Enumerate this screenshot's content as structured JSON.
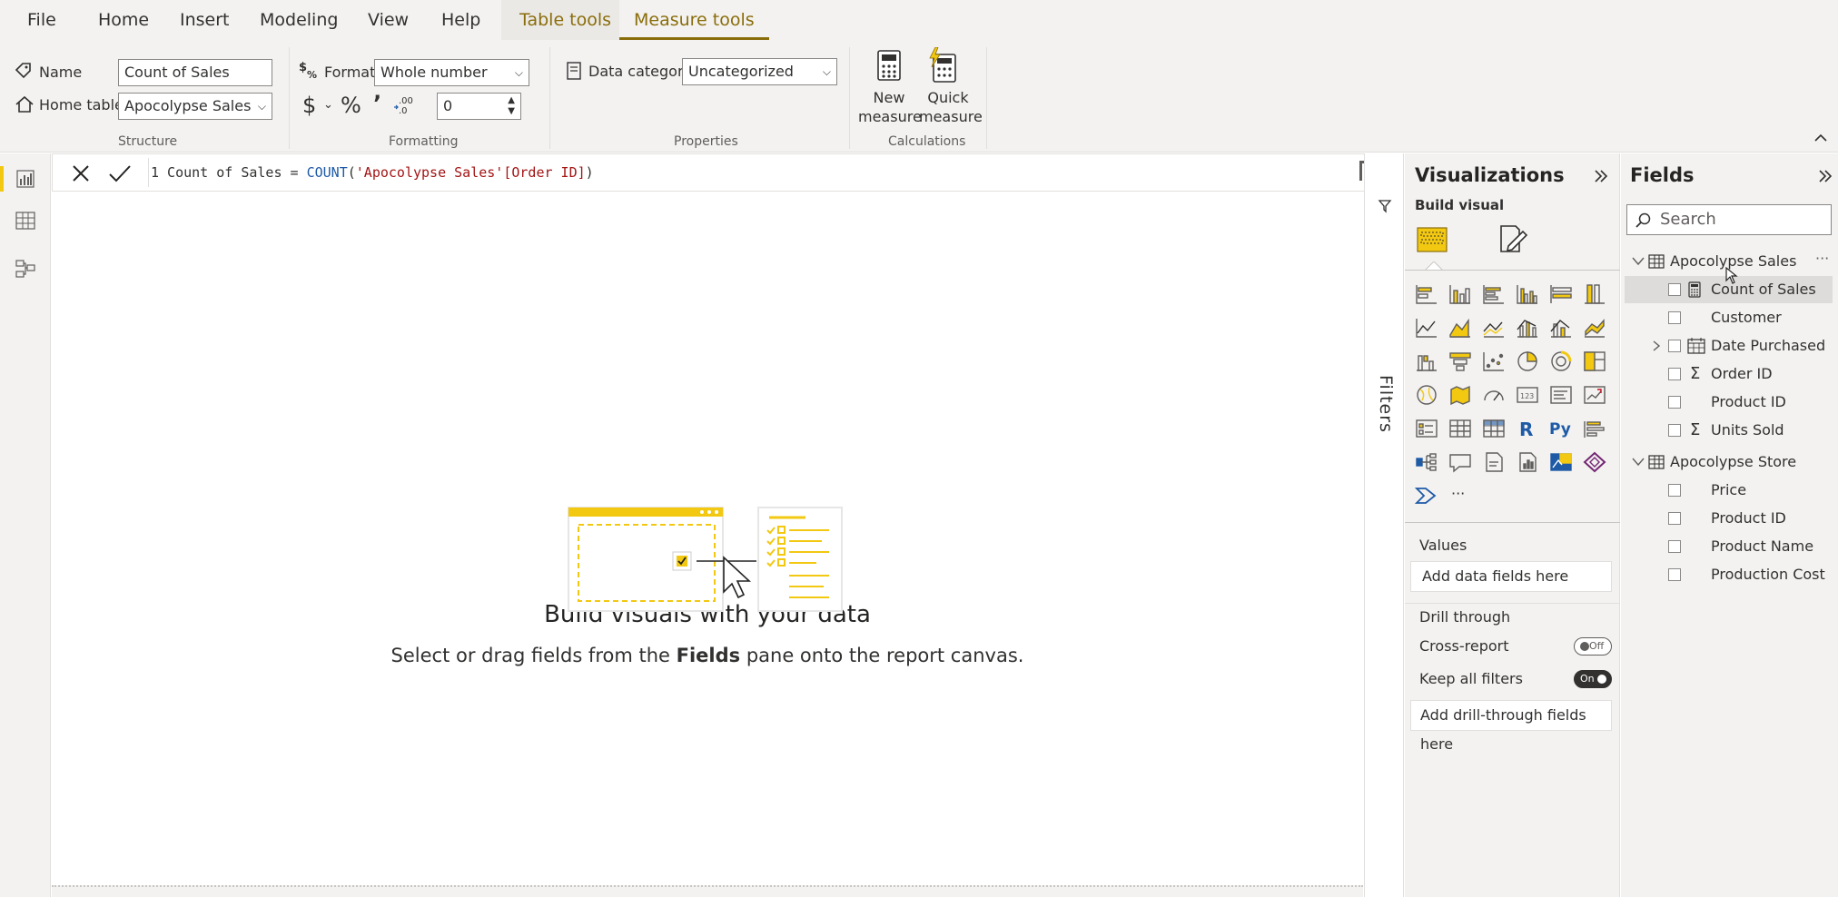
{
  "menu": {
    "items": [
      "File",
      "Home",
      "Insert",
      "Modeling",
      "View",
      "Help"
    ],
    "context_tabs": [
      "Table tools",
      "Measure tools"
    ]
  },
  "ribbon": {
    "structure": {
      "name_label": "Name",
      "name_value": "Count of Sales",
      "home_table_label": "Home table",
      "home_table_value": "Apocolypse Sales",
      "group_label": "Structure"
    },
    "formatting": {
      "format_label": "Format",
      "format_value": "Whole number",
      "currency_symbol": "$",
      "percent_symbol": "%",
      "comma_symbol": ")",
      "decimals_value": "0",
      "group_label": "Formatting"
    },
    "properties": {
      "data_category_label": "Data category",
      "data_category_value": "Uncategorized",
      "group_label": "Properties"
    },
    "calculations": {
      "new_measure_line1": "New",
      "new_measure_line2": "measure",
      "quick_measure_line1": "Quick",
      "quick_measure_line2": "measure",
      "group_label": "Calculations"
    }
  },
  "formula_bar": {
    "line_number": "1",
    "expression_prefix": " Count of Sales = ",
    "function_name": "COUNT",
    "open_paren": "(",
    "argument": "'Apocolypse Sales'[Order ID]",
    "close_paren": ")"
  },
  "canvas": {
    "title": "Build visuals with your data",
    "subtitle_before": "Select or drag fields from the ",
    "subtitle_bold": "Fields",
    "subtitle_after": " pane onto the report canvas."
  },
  "filters": {
    "label": "Filters"
  },
  "visualizations": {
    "title": "Visualizations",
    "build_visual_label": "Build visual",
    "values_label": "Values",
    "values_placeholder": "Add data fields here",
    "drill_through_label": "Drill through",
    "cross_report_label": "Cross-report",
    "cross_report_state": "Off",
    "keep_filters_label": "Keep all filters",
    "keep_filters_state": "On",
    "drill_placeholder": "Add drill-through fields here",
    "more_label": "···"
  },
  "fields": {
    "title": "Fields",
    "search_placeholder": "Search",
    "tables": [
      {
        "name": "Apocolypse Sales",
        "fields": [
          "Count of Sales",
          "Customer",
          "Date Purchased",
          "Order ID",
          "Product ID",
          "Units Sold"
        ]
      },
      {
        "name": "Apocolypse Store",
        "fields": [
          "Price",
          "Product ID",
          "Product Name",
          "Production Cost"
        ]
      }
    ],
    "more_label": "···"
  },
  "colors": {
    "accent_yellow": "#f2c811",
    "context_tab_text": "#8a6d0b",
    "pane_background": "#f3f2f1"
  }
}
